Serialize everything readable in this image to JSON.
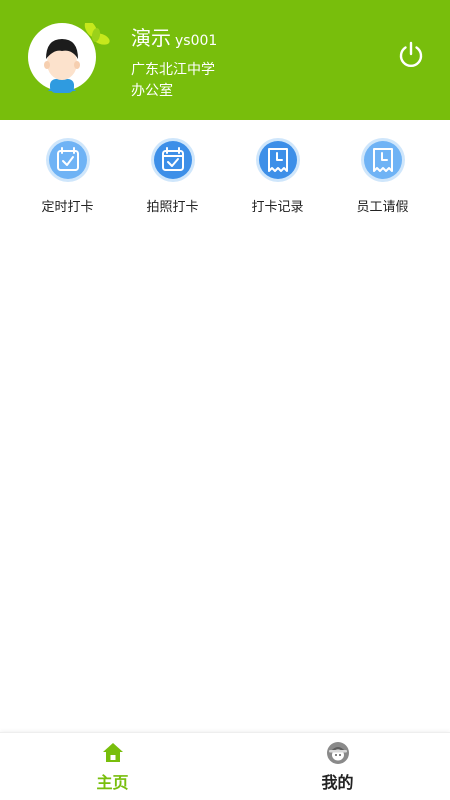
{
  "header": {
    "name": "演示",
    "user_id": "ys001",
    "school": "广东北江中学",
    "department": "办公室",
    "power_icon": "power-icon",
    "avatar_icon": "avatar-icon"
  },
  "actions": [
    {
      "label": "定时打卡",
      "icon": "calendar-check-icon"
    },
    {
      "label": "拍照打卡",
      "icon": "calendar-check-icon"
    },
    {
      "label": "打卡记录",
      "icon": "clock-receipt-icon"
    },
    {
      "label": "员工请假",
      "icon": "clock-receipt-icon"
    }
  ],
  "bottom_nav": {
    "home_label": "主页",
    "mine_label": "我的",
    "home_icon": "home-icon",
    "mine_icon": "helmet-avatar-icon"
  },
  "colors": {
    "brand_green": "#78be0c",
    "icon_blue": "#3d8fe8",
    "icon_blue_light": "#6fb3f5",
    "text_dark": "#222222"
  }
}
